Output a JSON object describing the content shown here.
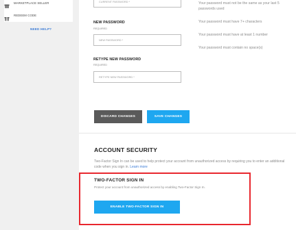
{
  "sidebar": {
    "items": [
      {
        "label": "MARKETPLACE SELLER",
        "icon": "storefront-icon"
      },
      {
        "label": "REDEEM CODE",
        "icon": "gift-icon"
      }
    ],
    "need_help": "NEED HELP?"
  },
  "form": {
    "current_password": {
      "placeholder": "CURRENT PASSWORD *"
    },
    "new_password": {
      "label": "NEW PASSWORD",
      "required": "REQUIRED",
      "placeholder": "NEW PASSWORD *"
    },
    "retype_password": {
      "label": "RETYPE NEW PASSWORD",
      "required": "REQUIRED",
      "placeholder": "RETYPE NEW PASSWORD *"
    },
    "discard_label": "DISCARD CHANGES",
    "save_label": "SAVE CHANGES"
  },
  "rules": [
    "Your password must not be the same as your last 5",
    "passwords used",
    "Your password must have 7+ characters",
    "Your password must have at least 1 number",
    "Your password must contain no space(s)"
  ],
  "security": {
    "title": "ACCOUNT SECURITY",
    "desc_line1": "Two-Factor Sign In can be used to help protect your account from unauthorized access by requiring you to enter an",
    "desc_line2": "additional code when you sign in.",
    "learn_more": "Learn more",
    "two_factor": {
      "title": "TWO-FACTOR SIGN IN",
      "desc": "Protect your account from unauthorized access by enabling Two-Factor Sign In.",
      "enable_label": "ENABLE TWO-FACTOR SIGN IN"
    }
  },
  "colors": {
    "accent": "#1ea7f0",
    "discard": "#5a5a5a",
    "highlight": "#e8262d",
    "link": "#3a7bd5"
  }
}
